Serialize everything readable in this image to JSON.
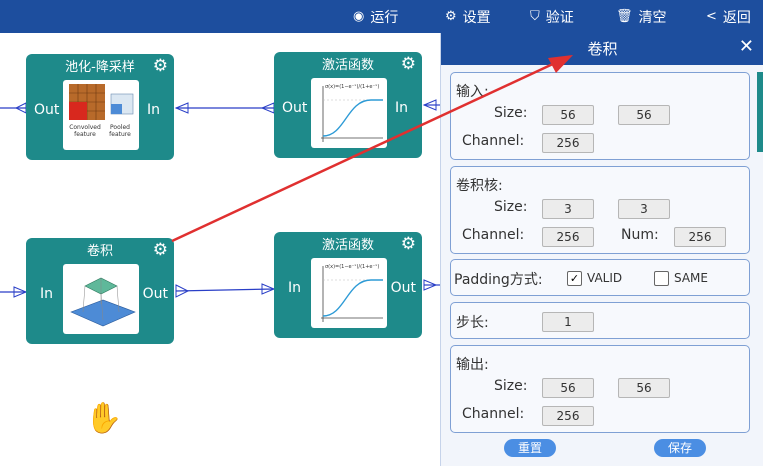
{
  "toolbar": {
    "items": [
      {
        "icon": "play-circle-icon",
        "glyph": "◉",
        "label": "运行"
      },
      {
        "icon": "gear-icon",
        "glyph": "⚙",
        "label": "设置"
      },
      {
        "icon": "shield-check-icon",
        "glyph": "⛉",
        "label": "验证"
      },
      {
        "icon": "trash-icon",
        "glyph": "🗑",
        "label": "清空"
      },
      {
        "icon": "chevron-left-icon",
        "glyph": "<",
        "label": "返回"
      }
    ]
  },
  "nodes": {
    "pool": {
      "title": "池化-降采样",
      "in": "In",
      "out": "Out",
      "caption_left": "Convolved feature",
      "caption_right": "Pooled feature"
    },
    "act1": {
      "title": "激活函数",
      "in": "In",
      "out": "Out"
    },
    "conv": {
      "title": "卷积",
      "in": "In",
      "out": "Out"
    },
    "act2": {
      "title": "激活函数",
      "in": "In",
      "out": "Out"
    }
  },
  "panel": {
    "title": "卷积",
    "input": {
      "heading": "输入:",
      "size_label": "Size:",
      "size_w": "56",
      "size_h": "56",
      "channel_label": "Channel:",
      "channel": "256"
    },
    "kernel": {
      "heading": "卷积核:",
      "size_label": "Size:",
      "size_w": "3",
      "size_h": "3",
      "channel_label": "Channel:",
      "channel": "256",
      "num_label": "Num:",
      "num": "256"
    },
    "padding": {
      "label": "Padding方式:",
      "option_valid": "VALID",
      "option_same": "SAME",
      "selected": "VALID"
    },
    "stride": {
      "label": "步长:",
      "value": "1"
    },
    "output": {
      "heading": "输出:",
      "size_label": "Size:",
      "size_w": "56",
      "size_h": "56",
      "channel_label": "Channel:",
      "channel": "256"
    },
    "reset_label": "重置",
    "save_label": "保存"
  },
  "colors": {
    "toolbar": "#1d4e9e",
    "node": "#1e8a8a",
    "edge": "#2a3fc7",
    "arrow": "#e03030",
    "button": "#4b8ee3"
  }
}
